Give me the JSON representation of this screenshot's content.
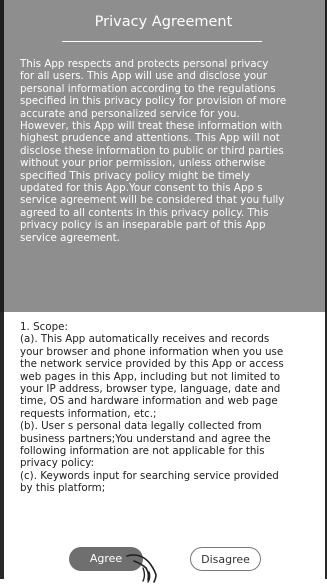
{
  "dialog": {
    "title": "Privacy Agreement",
    "intro_text": "This App respects and protects personal privacy\nfor all users. This App will use and disclose your\npersonal information according to the regulations\nspecified in this privacy policy for provision of more\naccurate and personalized service for you.\nHowever, this App will treat these information with\nhighest prudence and attentions. This App will not\ndisclose these information to public or third parties\nwithout your prior permission, unless otherwise\nspecified This privacy policy might be timely\nupdated for this App.Your consent to this App s\nservice agreement will be considered that you fully\nagreed to all contents in this privacy policy. This\nprivacy policy is an inseparable part of this App\nservice agreement.",
    "scope_text": "1. Scope:\n(a). This App automatically receives and records\nyour browser and phone information when you use\nthe network service provided by this App or access\nweb pages in this App, including but not limited to\nyour IP address, browser type, language, date and\ntime, OS and hardware information and web page\nrequests information, etc.;\n(b). User s personal data legally collected from\nbusiness partners;You understand and agree the\nfollowing information are not applicable for this\nprivacy policy:\n(c). Keywords input for searching service provided\nby this platform;",
    "agree_label": "Agree",
    "disagree_label": "Disagree"
  },
  "colors": {
    "panel": "#8e8e8e",
    "agree_button": "#6f6f6f",
    "text_dark": "#222222",
    "text_light": "#ffffff"
  },
  "icons": [
    "pointing-hand-icon"
  ]
}
